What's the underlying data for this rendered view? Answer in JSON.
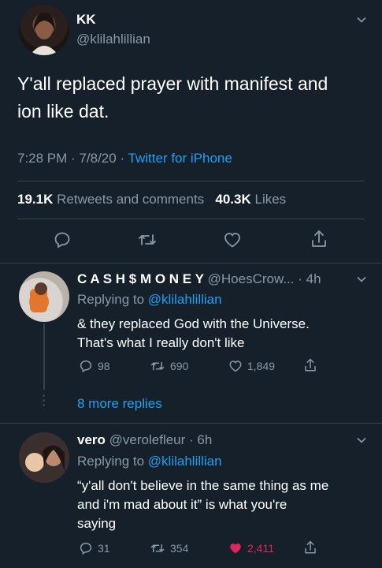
{
  "main_tweet": {
    "display_name": "KK",
    "handle": "@klilahlillian",
    "text_line1": "Y'all replaced prayer with manifest and",
    "text_line2": "ion like dat.",
    "time": "7:28 PM",
    "date": "7/8/20",
    "source": "Twitter for iPhone",
    "retweets_count": "19.1K",
    "retweets_label": "Retweets and comments",
    "likes_count": "40.3K",
    "likes_label": "Likes"
  },
  "reply1": {
    "display_name": "C A S H $ M O N E Y",
    "handle": "@HoesCrow...",
    "age": "· 4h",
    "replying_prefix": "Replying to",
    "replying_to": "@klilahlillian",
    "text_line1": "& they replaced God with the Universe.",
    "text_line2": "That's what I really don't like",
    "replies": "98",
    "retweets": "690",
    "likes": "1,849"
  },
  "more_replies": "8 more replies",
  "reply2": {
    "display_name": "vero",
    "handle": "@verolefleur",
    "age": "· 6h",
    "replying_prefix": "Replying to",
    "replying_to": "@klilahlillian",
    "text_line1": "“y'all don't believe in the same thing as me",
    "text_line2": "and i'm mad about it” is what you're",
    "text_line3": "saying",
    "replies": "31",
    "retweets": "354",
    "likes": "2,411"
  },
  "colors": {
    "background": "#15202b",
    "link": "#1da1f2",
    "muted": "#8899a6",
    "like_active": "#e0245e",
    "divider": "#38444d"
  }
}
